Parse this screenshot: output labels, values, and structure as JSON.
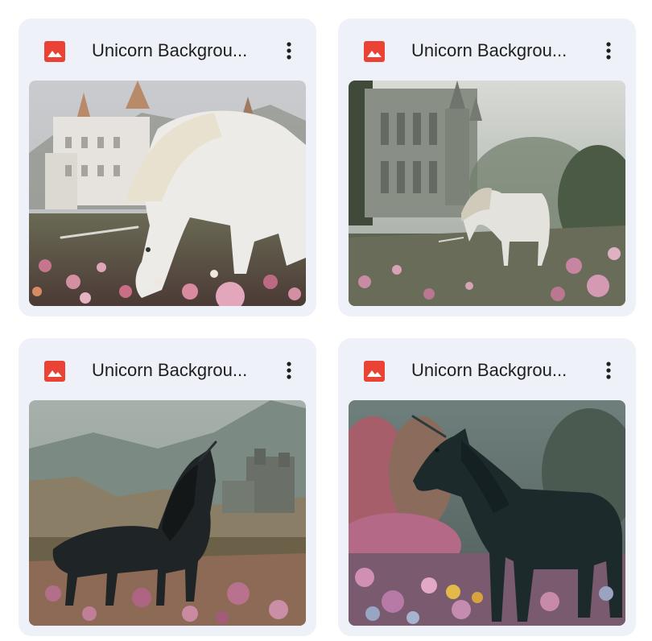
{
  "files": [
    {
      "title": "Unicorn Backgrou...",
      "icon": "image-file-icon",
      "thumbnail": "white-unicorn-grazing-closeup-castle"
    },
    {
      "title": "Unicorn Backgrou...",
      "icon": "image-file-icon",
      "thumbnail": "white-unicorn-misty-castle-meadow"
    },
    {
      "title": "Unicorn Backgrou...",
      "icon": "image-file-icon",
      "thumbnail": "black-unicorn-ruined-castle-valley"
    },
    {
      "title": "Unicorn Backgrou...",
      "icon": "image-file-icon",
      "thumbnail": "black-unicorn-pink-flower-forest"
    }
  ],
  "colors": {
    "card_background": "#eef1f7",
    "image_icon": "#ea4335",
    "title_text": "#1f1f1f"
  }
}
